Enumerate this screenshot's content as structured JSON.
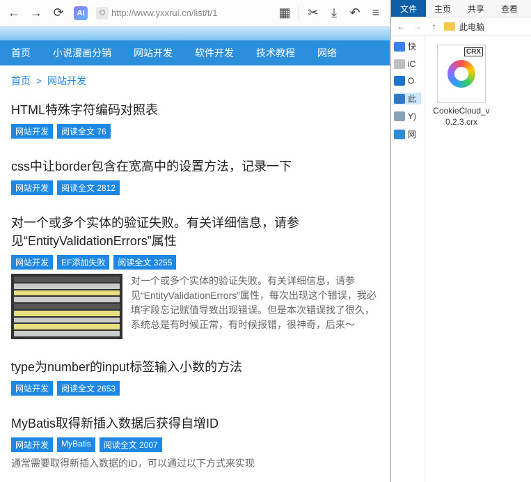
{
  "toolbar": {
    "url": "http://www.yxxrui.cn/list/t/1"
  },
  "nav": {
    "items": [
      "首页",
      "小说漫画分销",
      "网站开发",
      "软件开发",
      "技术教程",
      "网络"
    ]
  },
  "breadcrumb": {
    "home": "首页",
    "sep": ">",
    "cat": "网站开发"
  },
  "posts": [
    {
      "title": "HTML特殊字符编码对照表",
      "tags": [
        "网站开发",
        "阅读全文 76"
      ]
    },
    {
      "title": "css中让border包含在宽高中的设置方法，记录一下",
      "tags": [
        "网站开发",
        "阅读全文 2812"
      ]
    },
    {
      "title": "对一个或多个实体的验证失败。有关详细信息，请参见“EntityValidationErrors”属性",
      "tags": [
        "网站开发",
        "EF添加失败",
        "阅读全文 3255"
      ],
      "excerpt": "对一个或多个实体的验证失败。有关详细信息，请参见“EntityValidationErrors”属性，每次出现这个错误，我必填字段忘记赋值导致出现错误。但是本次错误找了很久，系统总是有时候正常，有时候报错，很神奇，后来～"
    },
    {
      "title": "type为number的input标签输入小数的方法",
      "tags": [
        "网站开发",
        "阅读全文 2653"
      ]
    },
    {
      "title": "MyBatis取得新插入数据后获得自增ID",
      "tags": [
        "网站开发",
        "MyBatis",
        "阅读全文 2007"
      ],
      "excerpt_inline": "通常需要取得新插入数据的ID，可以通过以下方式来实现"
    }
  ],
  "explorer": {
    "tabs": {
      "active": "文件",
      "items": [
        "主页",
        "共享",
        "查看"
      ]
    },
    "addr": "此电脑",
    "sidebar": [
      {
        "icon": "star",
        "label": "快"
      },
      {
        "icon": "cloud",
        "label": "iC"
      },
      {
        "icon": "onedrive",
        "label": "O"
      },
      {
        "icon": "pc",
        "label": "此",
        "sel": true
      },
      {
        "icon": "disk",
        "label": "Y)"
      },
      {
        "icon": "net",
        "label": "网"
      }
    ],
    "file": {
      "badge": "CRX",
      "name": "CookieCloud_v0.2.3.crx"
    }
  }
}
